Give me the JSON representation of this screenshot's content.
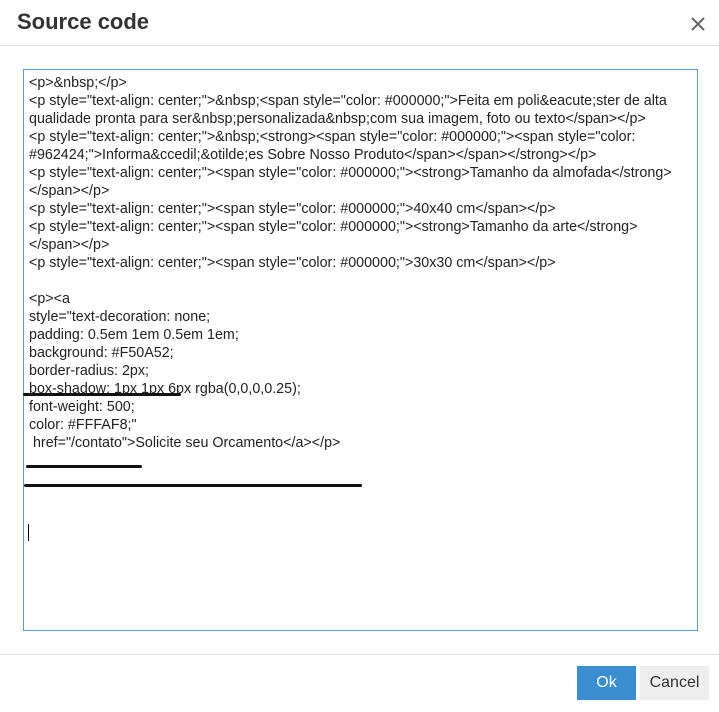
{
  "dialog": {
    "title": "Source code",
    "close_icon": "close-icon",
    "ok_label": "Ok",
    "cancel_label": "Cancel"
  },
  "editor": {
    "content": "<p>&nbsp;</p>\n<p style=\"text-align: center;\">&nbsp;<span style=\"color: #000000;\">Feita em poli&eacute;ster de alta qualidade pronta para ser&nbsp;personalizada&nbsp;com sua imagem, foto ou texto</span></p>\n<p style=\"text-align: center;\">&nbsp;<strong><span style=\"color: #000000;\"><span style=\"color: #962424;\">Informa&ccedil;&otilde;es Sobre Nosso Produto</span></span></strong></p>\n<p style=\"text-align: center;\"><span style=\"color: #000000;\"><strong>Tamanho da almofada</strong></span></p>\n<p style=\"text-align: center;\"><span style=\"color: #000000;\">40x40 cm</span></p>\n<p style=\"text-align: center;\"><span style=\"color: #000000;\"><strong>Tamanho da arte</strong></span></p>\n<p style=\"text-align: center;\"><span style=\"color: #000000;\">30x30 cm</span></p>\n\n<p><a\nstyle=\"text-decoration: none;\npadding: 0.5em 1em 0.5em 1em;\nbackground: #F50A52;\nborder-radius: 2px;\nbox-shadow: 1px 1px 6px rgba(0,0,0,0.25);\nfont-weight: 500;\ncolor: #FFFAF8;\"\n href=\"/contato\">Solicite seu Orcamento</a></p>"
  },
  "colors": {
    "accent": "#3b8fd1",
    "editor_border": "#5b9bd5"
  }
}
